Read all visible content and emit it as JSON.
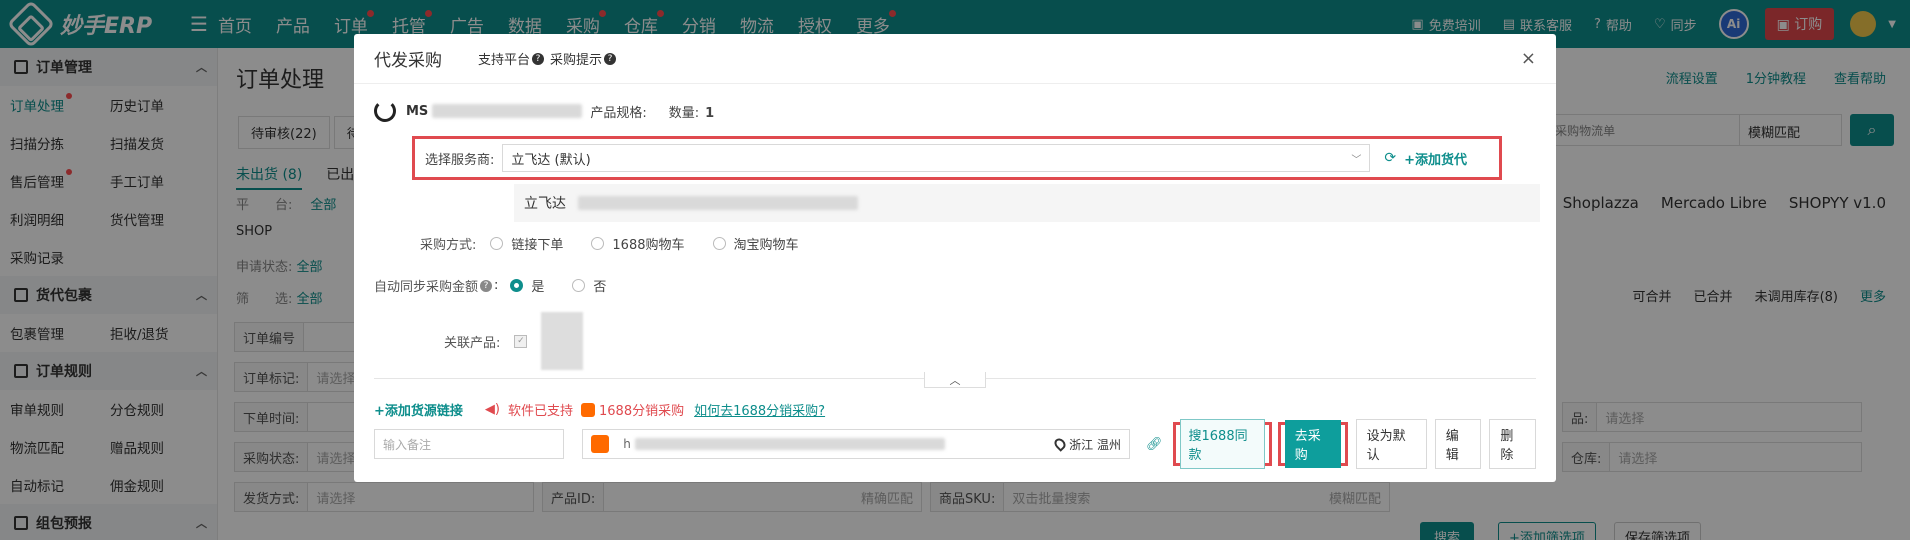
{
  "topnav": {
    "brand": "妙手ERP",
    "items": [
      {
        "label": "首页",
        "dot": false
      },
      {
        "label": "产品",
        "dot": false
      },
      {
        "label": "订单",
        "dot": true
      },
      {
        "label": "托管",
        "dot": true
      },
      {
        "label": "广告",
        "dot": false
      },
      {
        "label": "数据",
        "dot": false
      },
      {
        "label": "采购",
        "dot": true
      },
      {
        "label": "仓库",
        "dot": true
      },
      {
        "label": "分销",
        "dot": false
      },
      {
        "label": "物流",
        "dot": false
      },
      {
        "label": "授权",
        "dot": false
      },
      {
        "label": "更多",
        "dot": true
      }
    ],
    "right": {
      "training": "免费培训",
      "support": "联系客服",
      "help": "帮助",
      "sync": "同步",
      "ai": "Ai",
      "order_btn": "订购"
    }
  },
  "sidebar": {
    "groups": [
      {
        "title": "订单管理",
        "rows": [
          [
            "订单处理",
            "历史订单"
          ],
          [
            "扫描分拣",
            "扫描发货"
          ],
          [
            "售后管理",
            "手工订单"
          ],
          [
            "利润明细",
            "货代管理"
          ],
          [
            "采购记录",
            ""
          ]
        ]
      },
      {
        "title": "货代包裹",
        "rows": [
          [
            "包裹管理",
            "拒收/退货"
          ]
        ]
      },
      {
        "title": "订单规则",
        "rows": [
          [
            "审单规则",
            "分仓规则"
          ],
          [
            "物流匹配",
            "赠品规则"
          ],
          [
            "自动标记",
            "佣金规则"
          ]
        ]
      },
      {
        "title": "组包预报",
        "rows": []
      }
    ]
  },
  "main": {
    "title": "订单处理",
    "toplinks": [
      "流程设置",
      "1分钟教程",
      "查看帮助"
    ],
    "tabs": [
      "待审核(22)",
      "待"
    ],
    "search_placeholder": "/运单号/采购单号/采购物流单",
    "match_mode": "模糊匹配",
    "subtabs": [
      "未出货 (8)",
      "已出货"
    ],
    "platform_label": "平　　台:",
    "platform_all": "全部",
    "shop_head": "SHOP",
    "shops": [
      "Shoplazza",
      "Mercado Libre",
      "SHOPYY v1.0"
    ],
    "apply_label": "申请状态:",
    "apply_all": "全部",
    "filter_label": "筛　　选:",
    "filter_all": "全部",
    "filter_right": [
      "可合并",
      "已合并",
      "未调用库存(8)",
      "更多"
    ],
    "fields": {
      "order_no": "订单编号",
      "order_mark": "订单标记:",
      "order_mark_ph": "请选择",
      "order_time": "下单时间:",
      "purchase_status": "采购状态:",
      "purchase_status_ph": "请选择",
      "ship_method": "发货方式:",
      "ship_method_ph": "请选择",
      "product_id": "产品ID:",
      "exact": "精确匹配",
      "sku": "商品SKU:",
      "sku_ph": "双击批量搜索",
      "fuzzy": "模糊匹配",
      "right1": "品:",
      "right1_ph": "请选择",
      "warehouse": "仓库:",
      "warehouse_ph": "请选择"
    },
    "buttons": {
      "search": "搜索",
      "add_filter": "+添加筛选项",
      "save_filter": "保存筛选项"
    }
  },
  "modal": {
    "title": "代发采购",
    "hint1": "支持平台",
    "hint2": "采购提示",
    "close": "×",
    "sku_prefix": "MS",
    "spec_label": "产品规格:",
    "qty_label": "数量:",
    "qty_value": "1",
    "supplier_label": "选择服务商:",
    "supplier_value": "立飞达 (默认)",
    "add_forwarder": "+添加货代",
    "supplier_info": "立飞达",
    "method_label": "采购方式:",
    "methods": [
      "链接下单",
      "1688购物车",
      "淘宝购物车"
    ],
    "sync_label": "自动同步采购金额",
    "sync_yes": "是",
    "sync_no": "否",
    "linked_label": "关联产品:",
    "add_source": "+添加货源链接",
    "support_text": "软件已支持",
    "ali_text": "1688分销采购",
    "how_text": "如何去1688分销采购?",
    "remark_ph": "输入备注",
    "url_prefix": "h",
    "location": "浙江 温州",
    "btn_search1688": "搜1688同款",
    "btn_purchase": "去采购",
    "btn_default": "设为默认",
    "btn_edit": "编辑",
    "btn_delete": "删除"
  },
  "colors": {
    "brand": "#0e8e8c",
    "alert": "#e04a4f"
  }
}
